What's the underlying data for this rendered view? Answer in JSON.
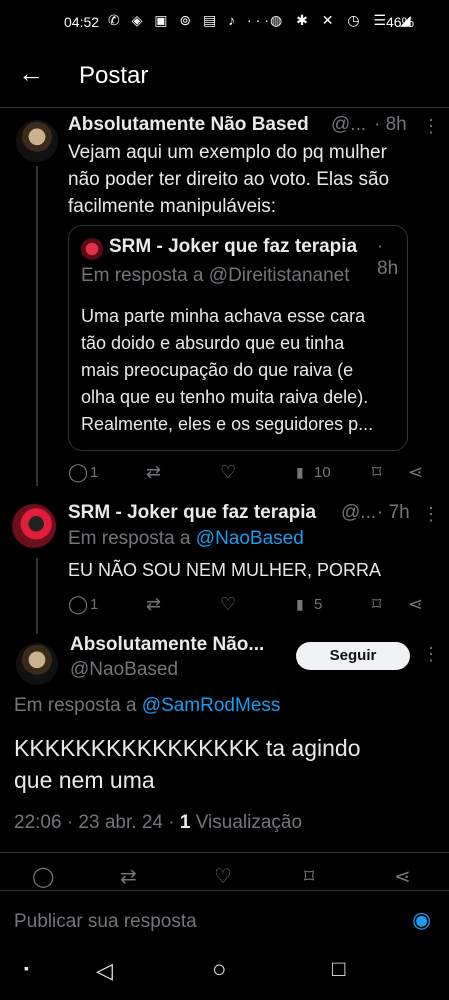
{
  "status": {
    "time": "04:52",
    "left_icons": "✆ ◈ ▣ ⊚ ▤ ♪ ···",
    "right_icons": "◍ ✱ ✕ ◷ ☰ ◢",
    "battery": "46%"
  },
  "header": {
    "back_icon": "←",
    "title": "Postar"
  },
  "tweet1": {
    "name": "Absolutamente Não Based",
    "handle": "@...",
    "time": "· 8h",
    "text_line1": "Vejam aqui um exemplo do pq mulher",
    "text_line2": "não poder ter direito ao voto. Elas são",
    "text_line3": "facilmente manipuláveis:",
    "quote": {
      "name": "SRM - Joker que faz terapia",
      "time": "· 8h",
      "reply_prefix": "Em resposta a ",
      "reply_handle": "@Direitistananet",
      "line1": "Uma parte minha achava esse cara",
      "line2": "tão doido e absurdo que eu tinha",
      "line3": "mais preocupação do que raiva (e",
      "line4": "olha que eu tenho muita raiva dele).",
      "line5": "Realmente, eles e os seguidores p..."
    },
    "actions": {
      "replies": "1",
      "views": "10"
    }
  },
  "tweet2": {
    "name": "SRM - Joker que faz terapia",
    "handle": "@...",
    "time": "· 7h",
    "reply_prefix": "Em resposta a ",
    "reply_handle": "@NaoBased",
    "text": "EU NÃO SOU NEM MULHER, PORRA",
    "actions": {
      "replies": "1",
      "views": "5"
    }
  },
  "main": {
    "name": "Absolutamente Não...",
    "handle": "@NaoBased",
    "follow_label": "Seguir",
    "reply_prefix": "Em resposta a ",
    "reply_handle": "@SamRodMess",
    "text_line1": "KKKKKKKKKKKKKKKK ta agindo",
    "text_line2": "que nem uma",
    "date": "22:06 · 23 abr. 24 · ",
    "views_count": "1",
    "views_label": " Visualização"
  },
  "reply_bar": {
    "placeholder": "Publicar sua resposta"
  },
  "icons": {
    "reply": "◯",
    "retweet": "⇄",
    "like": "♡",
    "views": "▮",
    "bookmark": "⌑",
    "share": "⋖",
    "more": "⋮",
    "camera": "◉",
    "nav_menu": "▪",
    "nav_back": "◁",
    "nav_home": "○",
    "nav_recent": "□"
  },
  "colors": {
    "accent": "#1d9bf0",
    "background": "#000000",
    "muted": "#71767b",
    "text": "#e7e9ea"
  }
}
